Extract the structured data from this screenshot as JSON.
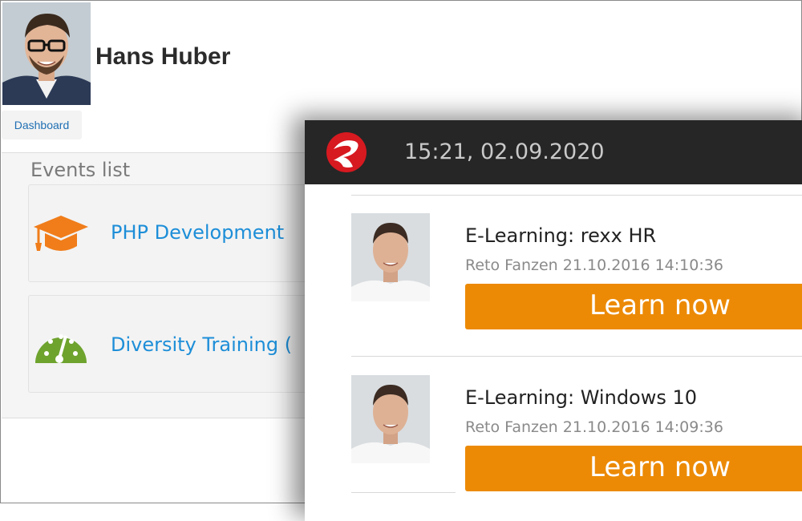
{
  "profile": {
    "name": "Hans Huber",
    "dashboard_label": "Dashboard"
  },
  "events": {
    "title": "Events list",
    "items": [
      {
        "label": "PHP Development",
        "icon": "graduation-cap-icon"
      },
      {
        "label": "Diversity Training (",
        "icon": "gauge-icon"
      }
    ]
  },
  "overlay": {
    "datetime": "15:21, 02.09.2020",
    "items": [
      {
        "title": "E-Learning: rexx HR",
        "meta": "Reto Fanzen 21.10.2016 14:10:36",
        "button": "Learn now"
      },
      {
        "title": "E-Learning: Windows 10",
        "meta": "Reto Fanzen 21.10.2016 14:09:36",
        "button": "Learn now"
      }
    ]
  },
  "colors": {
    "accent": "#ec8a06",
    "link": "#1d8ed8",
    "header": "#262626",
    "cap_icon": "#f07d1a",
    "gauge_icon": "#6ea32e",
    "logo": "#d71920"
  }
}
